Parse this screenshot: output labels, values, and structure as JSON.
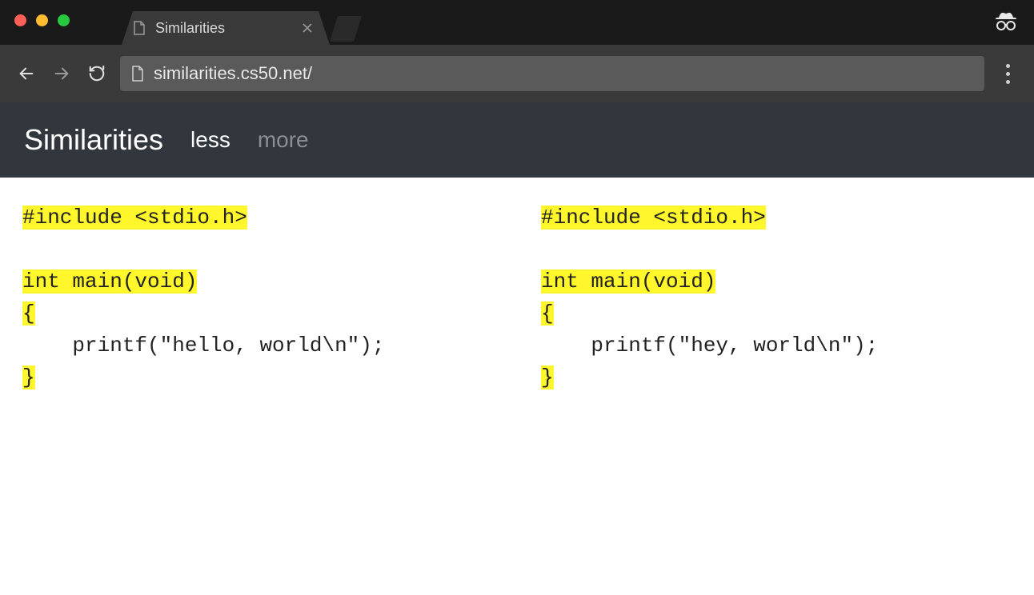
{
  "browser": {
    "tab_title": "Similarities",
    "url": "similarities.cs50.net/"
  },
  "header": {
    "brand": "Similarities",
    "nav": [
      {
        "label": "less",
        "active": true
      },
      {
        "label": "more",
        "active": false
      }
    ]
  },
  "code": {
    "left": {
      "lines": [
        {
          "segments": [
            {
              "t": "#include <stdio.h>",
              "hl": true
            }
          ]
        },
        {
          "segments": [
            {
              "t": " ",
              "hl": false
            }
          ]
        },
        {
          "segments": [
            {
              "t": "int main(void)",
              "hl": true
            }
          ]
        },
        {
          "segments": [
            {
              "t": "{",
              "hl": true
            }
          ]
        },
        {
          "segments": [
            {
              "t": "    printf(\"hello, world\\n\");",
              "hl": false
            }
          ]
        },
        {
          "segments": [
            {
              "t": "}",
              "hl": true
            }
          ]
        }
      ]
    },
    "right": {
      "lines": [
        {
          "segments": [
            {
              "t": "#include <stdio.h>",
              "hl": true
            }
          ]
        },
        {
          "segments": [
            {
              "t": " ",
              "hl": false
            }
          ]
        },
        {
          "segments": [
            {
              "t": "int main(void)",
              "hl": true
            }
          ]
        },
        {
          "segments": [
            {
              "t": "{",
              "hl": true
            }
          ]
        },
        {
          "segments": [
            {
              "t": "    printf(\"hey, world\\n\");",
              "hl": false
            }
          ]
        },
        {
          "segments": [
            {
              "t": "}",
              "hl": true
            }
          ]
        }
      ]
    }
  }
}
